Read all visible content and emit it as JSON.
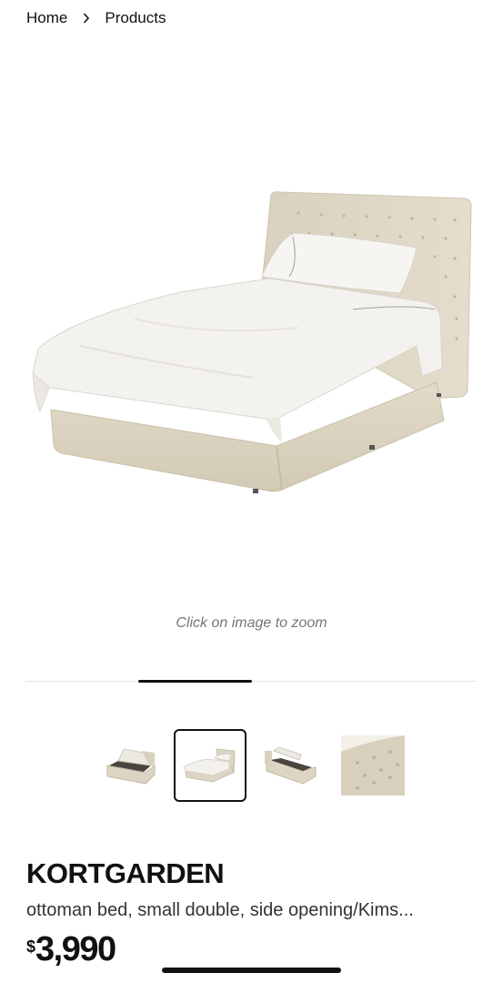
{
  "breadcrumb": {
    "home": "Home",
    "products": "Products"
  },
  "gallery": {
    "zoom_hint": "Click on image to zoom",
    "main_image": "bed-front-view",
    "thumbnails": [
      "bed-open-storage",
      "bed-front-view",
      "bed-open-storage-side",
      "headboard-closeup"
    ],
    "selected_index": 1
  },
  "product": {
    "name": "KORTGARDEN",
    "description": "ottoman bed, small double, side opening/Kims...",
    "currency": "$",
    "price": "3,990"
  },
  "colors": {
    "upholstery": "#e1dac9",
    "bedding": "#f5f3ef",
    "text": "#111111",
    "muted": "#767676"
  }
}
